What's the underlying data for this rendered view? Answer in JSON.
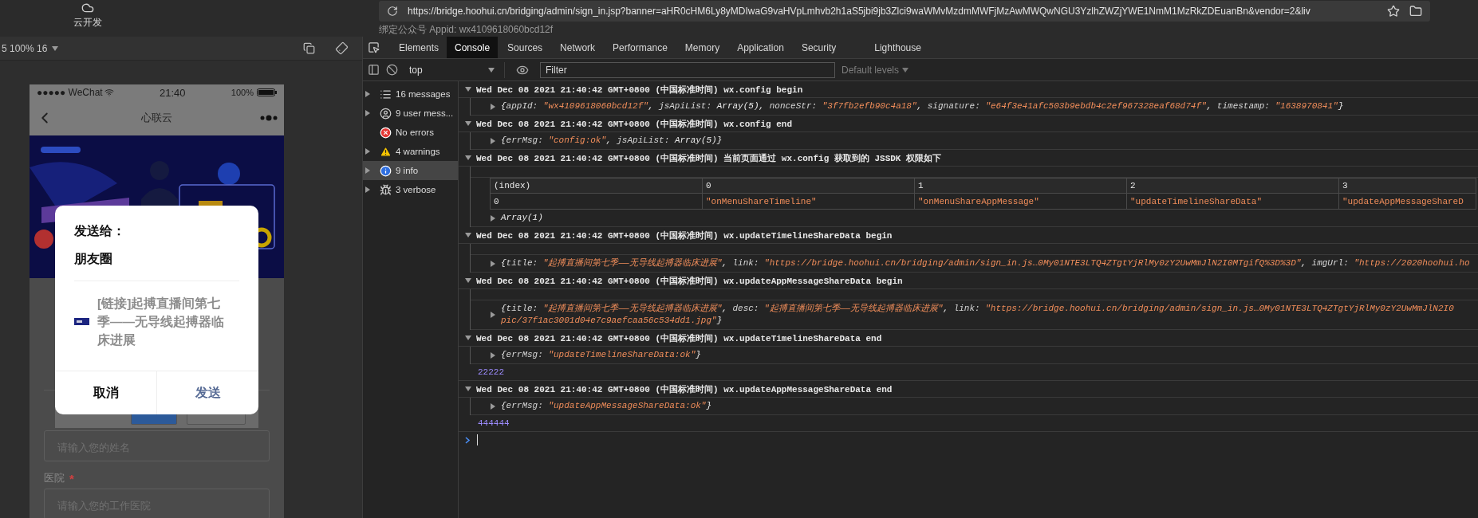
{
  "top_bar": {
    "cloud_label": "云开发",
    "url": "https://bridge.hoohui.cn/bridging/admin/sign_in.jsp?banner=aHR0cHM6Ly8yMDIwaG9vaHVpLmhvb2h1aS5jbi9jb3Zlci9waWMvMzdmMWFjMzAwMWQwNGU3YzlhZWZjYWE1NmM1MzRkZDEuanBn&vendor=2&liv",
    "appid_line": "绑定公众号 Appid: wx4109618060bcd12f"
  },
  "simulator": {
    "zoom_label": "5 100% 16",
    "status": {
      "carrier": "●●●●● WeChat",
      "time": "21:40",
      "battery": "100%"
    },
    "nav_title": "心联云",
    "name_placeholder": "请输入您的姓名",
    "hospital_label": "医院",
    "required_mark": "*",
    "hospital_placeholder": "请输入您的工作医院"
  },
  "share_dialog": {
    "title": "发送给：",
    "target": "朋友圈",
    "link_text": "[链接]起搏直播间第七季——无导线起搏器临床进展",
    "buttons": [
      {
        "label": "取消",
        "kind": "cancel"
      },
      {
        "label": "发送",
        "kind": "primary"
      }
    ]
  },
  "devtools": {
    "tabs": [
      {
        "label": "Elements",
        "selected": false
      },
      {
        "label": "Console",
        "selected": true
      },
      {
        "label": "Sources",
        "selected": false
      },
      {
        "label": "Network",
        "selected": false
      },
      {
        "label": "Performance",
        "selected": false
      },
      {
        "label": "Memory",
        "selected": false
      },
      {
        "label": "Application",
        "selected": false
      },
      {
        "label": "Security",
        "selected": false
      },
      {
        "label": "Lighthouse",
        "selected": false
      }
    ],
    "context": "top",
    "filter_placeholder": "Filter",
    "levels": "Default levels",
    "sidebar": [
      {
        "label": "16 messages",
        "kind": "list",
        "selected": false
      },
      {
        "label": "9 user mess...",
        "kind": "user",
        "selected": false
      },
      {
        "label": "No errors",
        "kind": "error",
        "selected": false
      },
      {
        "label": "4 warnings",
        "kind": "warning",
        "selected": false
      },
      {
        "label": "9 info",
        "kind": "info",
        "selected": true
      },
      {
        "label": "3 verbose",
        "kind": "verbose",
        "selected": false
      }
    ],
    "log": [
      {
        "kind": "group",
        "header": "Wed Dec 08 2021 21:40:42 GMT+0800 (中国标准时间) wx.config begin",
        "children": [
          {
            "kind": "object",
            "lines": [
              [
                {
                  "kind": "punct",
                  "text": "{"
                },
                {
                  "kind": "key",
                  "text": "appId: "
                },
                {
                  "kind": "string",
                  "text": "\"wx4109618060bcd12f\""
                },
                {
                  "kind": "punct",
                  "text": ", "
                },
                {
                  "kind": "key",
                  "text": "jsApiList: "
                },
                {
                  "kind": "punct",
                  "text": "Array(5), "
                },
                {
                  "kind": "key",
                  "text": "nonceStr: "
                },
                {
                  "kind": "string",
                  "text": "\"3f7fb2efb90c4a18\""
                },
                {
                  "kind": "punct",
                  "text": ", "
                },
                {
                  "kind": "key",
                  "text": "signature: "
                },
                {
                  "kind": "string",
                  "text": "\"e64f3e41afc503b9ebdb4c2ef967328eaf68d74f\""
                },
                {
                  "kind": "punct",
                  "text": ", "
                },
                {
                  "kind": "key",
                  "text": "timestamp: "
                },
                {
                  "kind": "string",
                  "text": "\"1638970841\""
                },
                {
                  "kind": "punct",
                  "text": "}"
                }
              ]
            ]
          }
        ]
      },
      {
        "kind": "group",
        "header": "Wed Dec 08 2021 21:40:42 GMT+0800 (中国标准时间) wx.config end",
        "children": [
          {
            "kind": "object",
            "lines": [
              [
                {
                  "kind": "punct",
                  "text": "{"
                },
                {
                  "kind": "key",
                  "text": "errMsg: "
                },
                {
                  "kind": "string",
                  "text": "\"config:ok\""
                },
                {
                  "kind": "punct",
                  "text": ", "
                },
                {
                  "kind": "key",
                  "text": "jsApiList: "
                },
                {
                  "kind": "punct",
                  "text": "Array(5)}"
                }
              ]
            ]
          }
        ]
      },
      {
        "kind": "group",
        "header": "Wed Dec 08 2021 21:40:42 GMT+0800 (中国标准时间) 当前页面通过 wx.config 获取到的 JSSDK 权限如下",
        "children": [
          {
            "kind": "spacer"
          },
          {
            "kind": "table",
            "columns": [
              "(index)",
              "0",
              "1",
              "2",
              "3"
            ],
            "rows": [
              [
                "0",
                "\"onMenuShareTimeline\"",
                "\"onMenuShareAppMessage\"",
                "\"updateTimelineShareData\"",
                "\"updateAppMessageShareD"
              ]
            ]
          },
          {
            "kind": "object",
            "lines": [
              [
                {
                  "kind": "punct",
                  "text": "Array(1)"
                }
              ]
            ]
          }
        ]
      },
      {
        "kind": "group",
        "header": "Wed Dec 08 2021 21:40:42 GMT+0800 (中国标准时间) wx.updateTimelineShareData begin",
        "children": [
          {
            "kind": "spacer"
          },
          {
            "kind": "object",
            "lines": [
              [
                {
                  "kind": "punct",
                  "text": "{"
                },
                {
                  "kind": "key",
                  "text": "title: "
                },
                {
                  "kind": "string",
                  "text": "\"起搏直播间第七季——无导线起搏器临床进展\""
                },
                {
                  "kind": "punct",
                  "text": ", "
                },
                {
                  "kind": "key",
                  "text": "link: "
                },
                {
                  "kind": "string",
                  "text": "\"https://bridge.hoohui.cn/bridging/admin/sign_in.js…0My01NTE3LTQ4ZTgtYjRlMy0zY2UwMmJlN2I0MTgifQ%3D%3D\""
                },
                {
                  "kind": "punct",
                  "text": ", "
                },
                {
                  "kind": "key",
                  "text": "imgUrl: "
                },
                {
                  "kind": "string",
                  "text": "\"https://2020hoohui.ho"
                }
              ]
            ]
          }
        ]
      },
      {
        "kind": "group",
        "header": "Wed Dec 08 2021 21:40:42 GMT+0800 (中国标准时间) wx.updateAppMessageShareData begin",
        "children": [
          {
            "kind": "spacer"
          },
          {
            "kind": "object",
            "lines": [
              [
                {
                  "kind": "punct",
                  "text": "{"
                },
                {
                  "kind": "key",
                  "text": "title: "
                },
                {
                  "kind": "string",
                  "text": "\"起搏直播间第七季——无导线起搏器临床进展\""
                },
                {
                  "kind": "punct",
                  "text": ", "
                },
                {
                  "kind": "key",
                  "text": "desc: "
                },
                {
                  "kind": "string",
                  "text": "\"起搏直播间第七季——无导线起搏器临床进展\""
                },
                {
                  "kind": "punct",
                  "text": ", "
                },
                {
                  "kind": "key",
                  "text": "link: "
                },
                {
                  "kind": "string",
                  "text": "\"https://bridge.hoohui.cn/bridging/admin/sign_in.js…0My01NTE3LTQ4ZTgtYjRlMy0zY2UwMmJlN2I0"
                }
              ],
              [
                {
                  "kind": "string",
                  "text": "pic/37f1ac3001d04e7c9aefcaa56c534dd1.jpg\""
                },
                {
                  "kind": "punct",
                  "text": "}"
                }
              ]
            ]
          }
        ]
      },
      {
        "kind": "group",
        "header": "Wed Dec 08 2021 21:40:42 GMT+0800 (中国标准时间) wx.updateTimelineShareData end",
        "children": [
          {
            "kind": "object",
            "lines": [
              [
                {
                  "kind": "punct",
                  "text": "{"
                },
                {
                  "kind": "key",
                  "text": "errMsg: "
                },
                {
                  "kind": "string",
                  "text": "\"updateTimelineShareData:ok\""
                },
                {
                  "kind": "punct",
                  "text": "}"
                }
              ]
            ]
          }
        ]
      },
      {
        "kind": "value",
        "text": "22222"
      },
      {
        "kind": "group",
        "header": "Wed Dec 08 2021 21:40:42 GMT+0800 (中国标准时间) wx.updateAppMessageShareData end",
        "children": [
          {
            "kind": "object",
            "lines": [
              [
                {
                  "kind": "punct",
                  "text": "{"
                },
                {
                  "kind": "key",
                  "text": "errMsg: "
                },
                {
                  "kind": "string",
                  "text": "\"updateAppMessageShareData:ok\""
                },
                {
                  "kind": "punct",
                  "text": "}"
                }
              ]
            ]
          }
        ]
      },
      {
        "kind": "value",
        "text": "444444"
      }
    ]
  }
}
